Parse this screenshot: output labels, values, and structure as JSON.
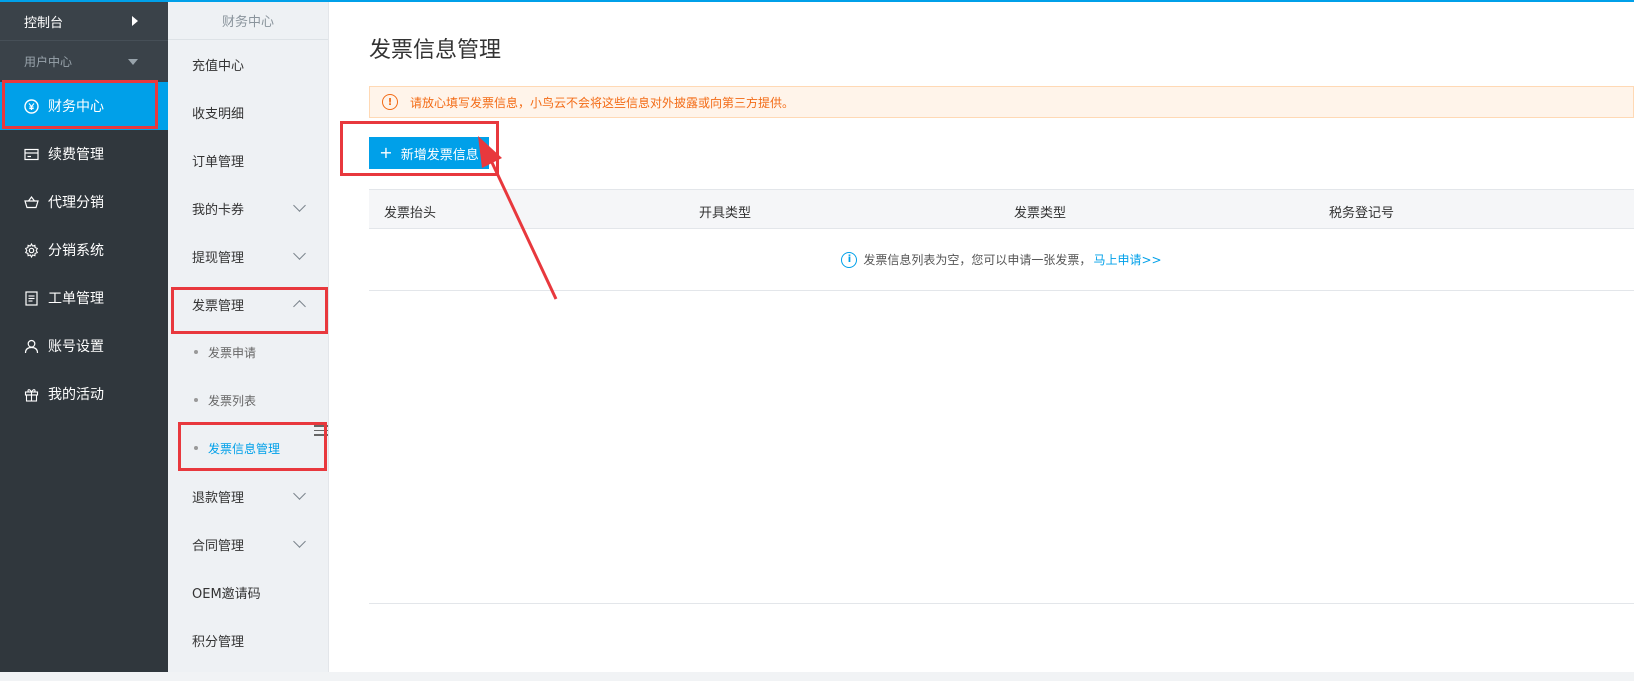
{
  "sidebar": {
    "console": "控制台",
    "user_center": "用户中心",
    "items": [
      {
        "label": "财务中心",
        "icon": "yen-circle-icon",
        "active": true
      },
      {
        "label": "续费管理",
        "icon": "card-icon"
      },
      {
        "label": "代理分销",
        "icon": "basket-icon"
      },
      {
        "label": "分销系统",
        "icon": "gear-icon"
      },
      {
        "label": "工单管理",
        "icon": "document-icon"
      },
      {
        "label": "账号设置",
        "icon": "user-icon"
      },
      {
        "label": "我的活动",
        "icon": "gift-icon"
      }
    ]
  },
  "subnav": {
    "header": "财务中心",
    "items": [
      {
        "label": "充值中心"
      },
      {
        "label": "收支明细"
      },
      {
        "label": "订单管理"
      },
      {
        "label": "我的卡券"
      },
      {
        "label": "提现管理"
      },
      {
        "label": "发票管理"
      },
      {
        "label": "退款管理"
      },
      {
        "label": "合同管理"
      },
      {
        "label": "OEM邀请码"
      },
      {
        "label": "积分管理"
      }
    ],
    "invoice_children": [
      {
        "label": "发票申请"
      },
      {
        "label": "发票列表"
      },
      {
        "label": "发票信息管理",
        "active": true
      }
    ]
  },
  "main": {
    "title": "发票信息管理",
    "notice": "请放心填写发票信息，小鸟云不会将这些信息对外披露或向第三方提供。",
    "add_button": "新增发票信息",
    "table": {
      "columns": [
        "发票抬头",
        "开具类型",
        "发票类型",
        "税务登记号"
      ],
      "empty_text": "发票信息列表为空，您可以申请一张发票，",
      "empty_link": "马上申请>>"
    }
  },
  "colors": {
    "accent": "#00a0e9",
    "annotation": "#e8383d",
    "warning": "#f36b16",
    "sidebar_bg": "#30373d"
  }
}
